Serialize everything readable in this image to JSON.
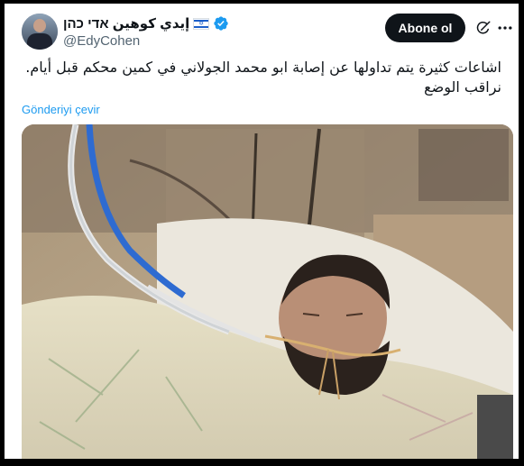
{
  "tweet": {
    "author": {
      "display_name": "إيدي كوهين אדי כהן",
      "handle": "@EdyCohen",
      "flag_icon": "israel-flag-icon",
      "verified_icon": "verified-badge-icon"
    },
    "follow_label": "Abone ol",
    "text": "اشاعات كثيرة يتم تداولها عن إصابة ابو محمد الجولاني في كمين محكم قبل أيام. نراقب الوضع",
    "translate_label": "Gönderiyi çevir",
    "icons": {
      "grok": "grok-icon",
      "more": "more-icon"
    }
  },
  "colors": {
    "text": "#0f1419",
    "secondary": "#536471",
    "link": "#1d9bf0",
    "verified": "#1d9bf0",
    "button": "#0f1419",
    "background": "#000000"
  }
}
